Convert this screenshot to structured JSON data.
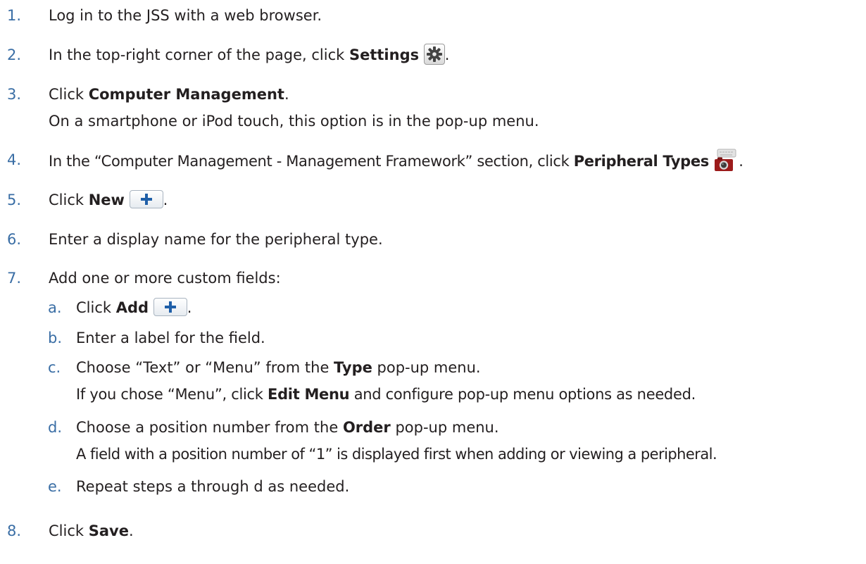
{
  "steps": [
    {
      "num": "1.",
      "text": "Log in to the JSS with a web browser."
    },
    {
      "num": "2.",
      "pre": "In the top-right corner of the page, click ",
      "bold": "Settings",
      "post": "."
    },
    {
      "num": "3.",
      "pre": "Click ",
      "bold": "Computer Management",
      "post": ".",
      "note": "On a smartphone or iPod touch, this option is in the pop-up menu."
    },
    {
      "num": "4.",
      "pre": "In the “Computer Management - Management Framework” section, click ",
      "bold": "Peripheral Types",
      "post": "."
    },
    {
      "num": "5.",
      "pre": "Click ",
      "bold": "New",
      "post": "."
    },
    {
      "num": "6.",
      "text": "Enter a display name for the peripheral type."
    },
    {
      "num": "7.",
      "text": "Add one or more custom fields:"
    },
    {
      "num": "8.",
      "pre": "Click ",
      "bold": "Save",
      "post": "."
    }
  ],
  "substeps": [
    {
      "num": "a.",
      "pre": "Click ",
      "bold": "Add",
      "post": "."
    },
    {
      "num": "b.",
      "text": "Enter a label for the field."
    },
    {
      "num": "c.",
      "pre": "Choose “Text” or “Menu” from the ",
      "bold": "Type",
      "post": " pop-up menu.",
      "note_pre": "If you chose “Menu”, click ",
      "note_bold": "Edit Menu",
      "note_post": " and configure pop-up menu options as needed."
    },
    {
      "num": "d.",
      "pre": "Choose a position number from the ",
      "bold": "Order",
      "post": " pop-up menu.",
      "note": "A field with a position number of “1” is displayed first when adding or viewing a peripheral."
    },
    {
      "num": "e.",
      "text": "Repeat steps a through d as needed."
    }
  ],
  "icons": {
    "settings": "gear-icon",
    "peripheral": "peripheral-types-icon",
    "plus": "plus-icon",
    "accent": "#1f5fa8",
    "number_color": "#3a6ea5"
  }
}
